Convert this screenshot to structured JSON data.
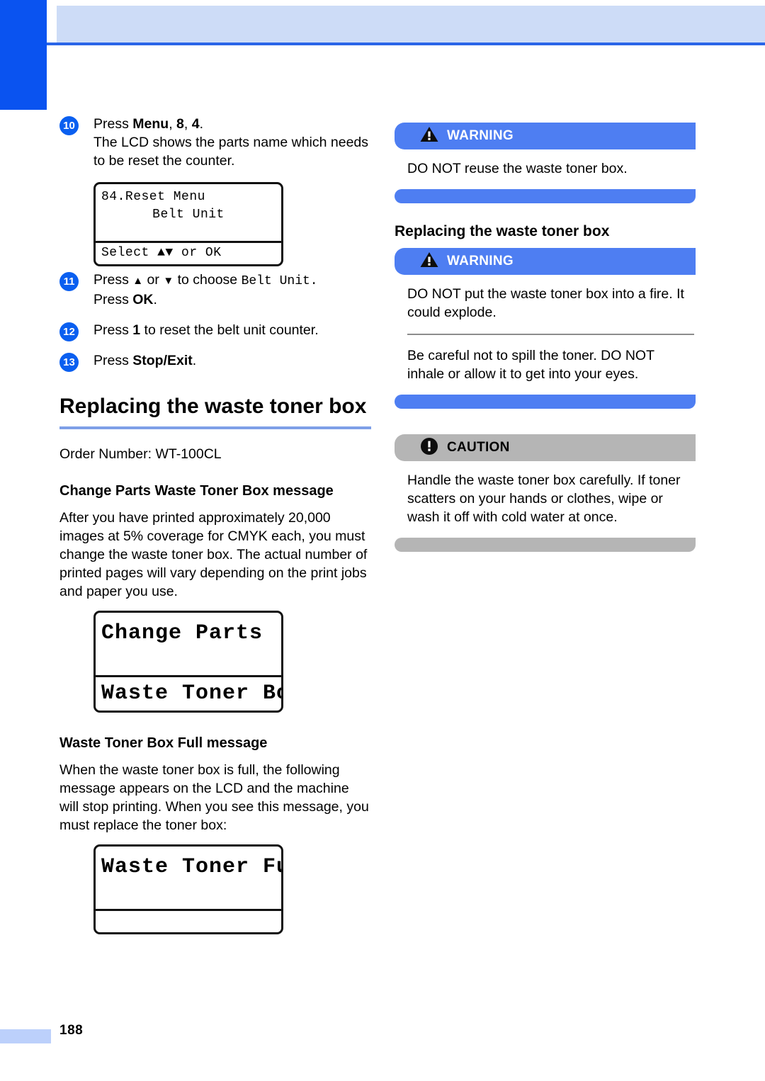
{
  "page": {
    "number": "188"
  },
  "left_column": {
    "steps": [
      {
        "num": "10",
        "text_parts": {
          "a": "Press ",
          "b": "Menu",
          "c": ", ",
          "d": "8",
          "e": ", ",
          "f": "4",
          "g": ".",
          "line2": "The LCD shows the parts name which needs to be reset the counter."
        }
      },
      {
        "num": "11",
        "text_parts": {
          "a": "Press ",
          "b": "▲",
          "c": " or ",
          "d": "▼",
          "e": " to choose ",
          "f": "Belt Unit.",
          "line2_a": "Press ",
          "line2_b": "OK",
          "line2_c": "."
        }
      },
      {
        "num": "12",
        "text_parts": {
          "a": "Press ",
          "b": "1",
          "c": " to reset the belt unit counter."
        }
      },
      {
        "num": "13",
        "text_parts": {
          "a": "Press ",
          "b": "Stop/Exit",
          "c": "."
        }
      }
    ],
    "lcd_reset_menu": {
      "line1": "84.Reset Menu",
      "line2": "",
      "line3": "Belt Unit",
      "status": "Select ▲▼ or OK"
    },
    "heading": "Replacing the waste toner box",
    "order_number": "Order Number: WT-100CL",
    "change_parts_heading": "Change Parts Waste Toner Box message",
    "change_parts_body": "After you have printed approximately 20,000 images at 5% coverage for CMYK each, you must change the waste toner box. The actual number of printed pages will vary depending on the print jobs and paper you use.",
    "lcd_change_parts": {
      "line1": "Change Parts",
      "status": "Waste Toner Box"
    },
    "full_message_heading": "Waste Toner Box Full message",
    "full_message_body": "When the waste toner box is full, the following message appears on the LCD and the machine will stop printing. When you see this message, you must replace the toner box:",
    "lcd_waste_toner_full": {
      "line1": "Waste Toner Full",
      "status": ""
    }
  },
  "right_column": {
    "warning_1": {
      "title": "WARNING",
      "body": "DO NOT reuse the waste toner box."
    },
    "heading": "Replacing the waste toner box",
    "warning_2": {
      "title": "WARNING",
      "body_1": "DO NOT put the waste toner box into a fire. It could explode.",
      "body_2": "Be careful not to spill the toner. DO NOT inhale or allow it to get into your eyes."
    },
    "caution": {
      "title": "CAUTION",
      "body": "Handle the waste toner box carefully. If toner scatters on your hands or clothes, wipe or wash it off with cold water at once."
    }
  },
  "colors": {
    "header_tab": "#0a53f0",
    "header_band": "#cddcf7",
    "header_rule": "#2a65e8",
    "step_bullet": "#0a5ff0",
    "heading_rule": "#7e9fe7",
    "warning_bar": "#4e7ef2",
    "caution_bar": "#b5b5b5",
    "footer_chip": "#bcd0fb"
  }
}
